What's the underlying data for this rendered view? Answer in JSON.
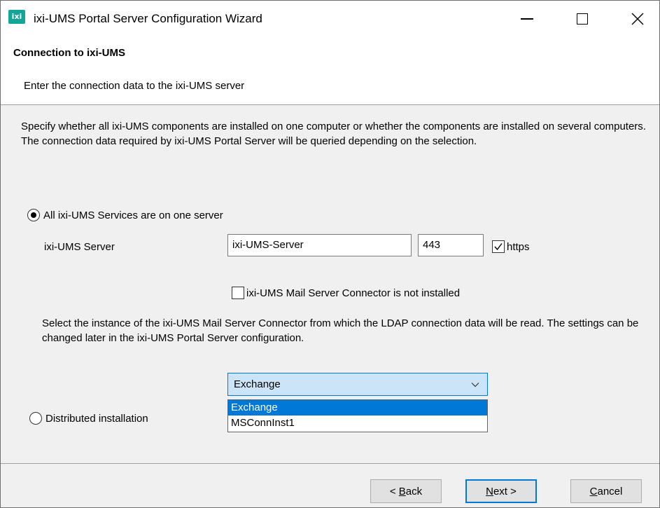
{
  "window": {
    "title": "ixi-UMS Portal Server Configuration Wizard",
    "icon_text": "ixi"
  },
  "header": {
    "title": "Connection to ixi-UMS",
    "subtitle": "Enter the connection data to the ixi-UMS server"
  },
  "intro_text": "Specify whether all ixi-UMS components are installed on one computer or whether the components are installed on several computers. The connection data required by ixi-UMS Portal Server will be queried depending on the selection.",
  "option_all": {
    "label": "All ixi-UMS Services are on one server",
    "selected": true
  },
  "server": {
    "label": "ixi-UMS Server",
    "name_value": "ixi-UMS-Server",
    "port_value": "443",
    "https_label": "https",
    "https_checked": true
  },
  "mail_connector": {
    "not_installed_label": "ixi-UMS Mail Server Connector is not installed",
    "not_installed_checked": false,
    "select_text": "Select the instance of the ixi-UMS Mail Server Connector from which the LDAP connection data will be read. The settings can be changed later in the ixi-UMS Portal Server configuration.",
    "selected_instance": "Exchange",
    "options": [
      "Exchange",
      "MSConnInst1"
    ]
  },
  "option_distributed": {
    "label": "Distributed installation",
    "selected": false
  },
  "buttons": {
    "back_prefix": "< ",
    "back_access": "B",
    "back_rest": "ack",
    "next_access": "N",
    "next_rest": "ext >",
    "cancel_access": "C",
    "cancel_rest": "ancel"
  },
  "colors": {
    "accent": "#0078d7",
    "combo_bg": "#cce4f7",
    "app_icon": "#13a59a"
  }
}
